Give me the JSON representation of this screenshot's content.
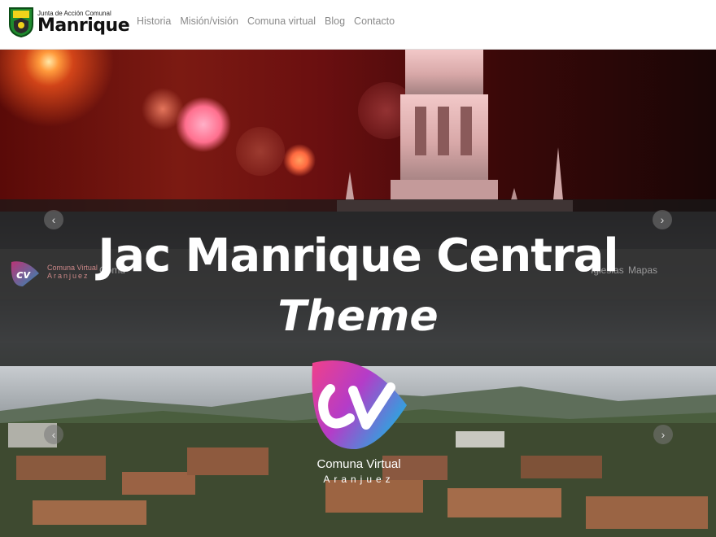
{
  "header": {
    "logo_small": "Junta de Acción Comunal",
    "logo_big": "Manrique",
    "nav": [
      "Historia",
      "Misión/visión",
      "Comuna virtual",
      "Blog",
      "Contacto"
    ]
  },
  "overlay": {
    "title": "Jac Manrique Central",
    "subtitle": "Theme"
  },
  "ghost": {
    "logo_text_1": "Comuna Virtual",
    "logo_text_2": "Aranjuez",
    "nav_partial_left": "Comu",
    "nav_partial_right_1": "Iglesias",
    "nav_partial_right_2": "Mapas"
  },
  "brand": {
    "logo_line1": "Comuna Virtual",
    "logo_line2": "Aranjuez"
  },
  "carousel": {
    "prev_icon": "‹",
    "next_icon": "›"
  },
  "colors": {
    "nav_text": "#8a8a8a",
    "overlay": "#191919",
    "brand_pink": "#e8348c",
    "brand_blue": "#2aa7e0"
  }
}
